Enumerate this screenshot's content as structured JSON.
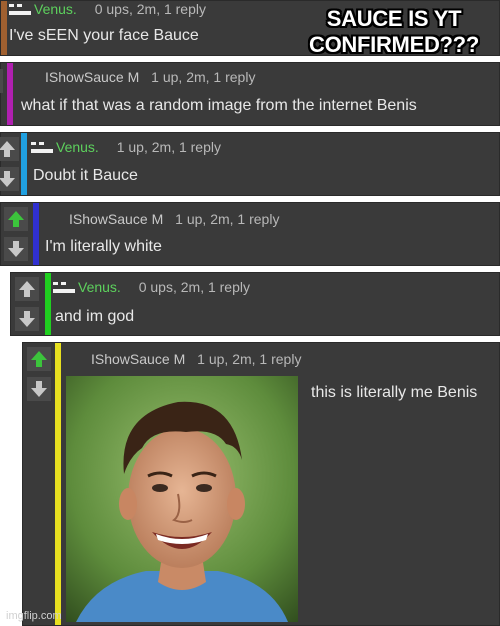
{
  "caption": "SAUCE IS YT CONFIRMED???",
  "watermark": "imgflip.com",
  "comments": [
    {
      "author": "Venus.",
      "flag": "",
      "stats": "0 ups, 2m, 1 reply",
      "text": "I've sEEN your face Bauce",
      "bar_color": "#a06030"
    },
    {
      "author": "IShowSauce",
      "flag": "M",
      "stats": "1 up, 2m, 1 reply",
      "text": "what if that was a random image from the internet Benis",
      "bar_color": "#b020b0"
    },
    {
      "author": "Venus.",
      "flag": "",
      "stats": "1 up, 2m, 1 reply",
      "text": "Doubt it Bauce",
      "bar_color": "#20a0e0"
    },
    {
      "author": "IShowSauce",
      "flag": "M",
      "stats": "1 up, 2m, 1 reply",
      "text": "I'm literally white",
      "bar_color": "#3030d0"
    },
    {
      "author": "Venus.",
      "flag": "",
      "stats": "0 ups, 2m, 1 reply",
      "text": "and im god",
      "bar_color": "#20d020"
    },
    {
      "author": "IShowSauce",
      "flag": "M",
      "stats": "1 up, 2m, 1 reply",
      "text": "this is literally me Benis",
      "bar_color": "#e8e020"
    }
  ],
  "vote_colors": {
    "up_active": "#3cc43c",
    "default": "#c8c8c8"
  }
}
